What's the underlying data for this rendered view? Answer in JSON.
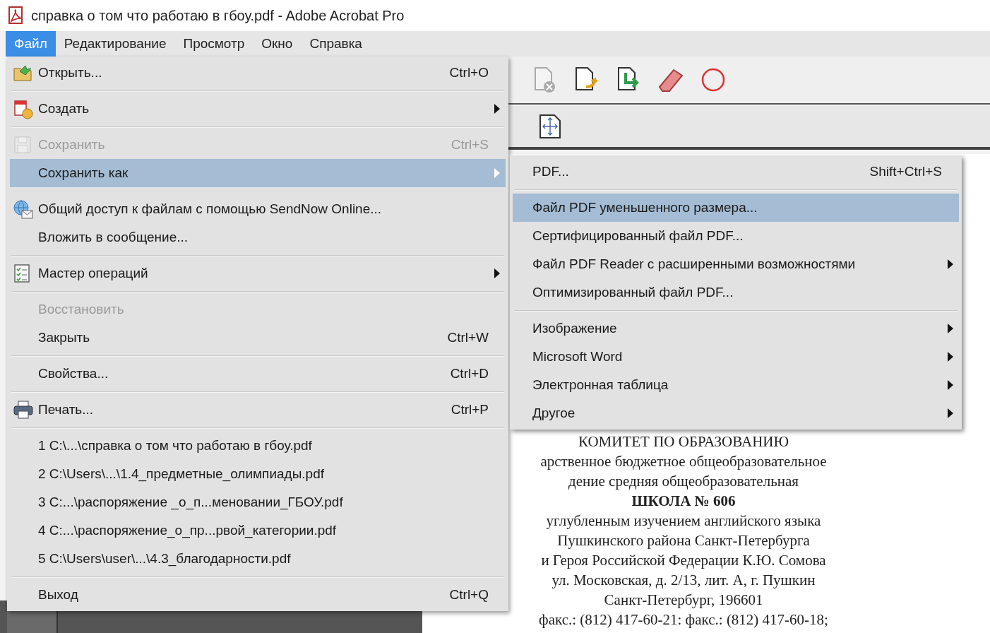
{
  "window": {
    "title": "справка о том что работаю в гбоу.pdf - Adobe Acrobat Pro"
  },
  "menubar": [
    {
      "label": "Файл",
      "selected": true
    },
    {
      "label": "Редактирование",
      "selected": false
    },
    {
      "label": "Просмотр",
      "selected": false
    },
    {
      "label": "Окно",
      "selected": false
    },
    {
      "label": "Справка",
      "selected": false
    }
  ],
  "file_menu": [
    {
      "kind": "item",
      "label": "Открыть...",
      "shortcut": "Ctrl+O",
      "has_submenu": false,
      "disabled": false,
      "selected": false
    },
    {
      "kind": "separator"
    },
    {
      "kind": "item",
      "label": "Создать",
      "has_submenu": true,
      "disabled": false,
      "selected": false
    },
    {
      "kind": "separator"
    },
    {
      "kind": "item",
      "label": "Сохранить",
      "shortcut": "Ctrl+S",
      "has_submenu": false,
      "disabled": true,
      "selected": false
    },
    {
      "kind": "item",
      "label": "Сохранить как",
      "has_submenu": true,
      "disabled": false,
      "selected": true
    },
    {
      "kind": "separator"
    },
    {
      "kind": "item",
      "label": "Общий доступ к файлам с помощью SendNow Online...",
      "has_submenu": false,
      "disabled": false,
      "selected": false
    },
    {
      "kind": "item",
      "label": "Вложить в сообщение...",
      "has_submenu": false,
      "disabled": false,
      "selected": false
    },
    {
      "kind": "separator"
    },
    {
      "kind": "item",
      "label": "Мастер операций",
      "has_submenu": true,
      "disabled": false,
      "selected": false
    },
    {
      "kind": "separator"
    },
    {
      "kind": "item",
      "label": "Восстановить",
      "has_submenu": false,
      "disabled": true,
      "selected": false
    },
    {
      "kind": "item",
      "label": "Закрыть",
      "shortcut": "Ctrl+W",
      "has_submenu": false,
      "disabled": false,
      "selected": false
    },
    {
      "kind": "separator"
    },
    {
      "kind": "item",
      "label": "Свойства...",
      "shortcut": "Ctrl+D",
      "has_submenu": false,
      "disabled": false,
      "selected": false
    },
    {
      "kind": "separator"
    },
    {
      "kind": "item",
      "label": "Печать...",
      "shortcut": "Ctrl+P",
      "has_submenu": false,
      "disabled": false,
      "selected": false
    },
    {
      "kind": "separator"
    },
    {
      "kind": "item",
      "label": "1 C:\\...\\справка о том что работаю в гбоу.pdf",
      "has_submenu": false,
      "disabled": false,
      "selected": false
    },
    {
      "kind": "item",
      "label": "2 C:\\Users\\...\\1.4_предметные_олимпиады.pdf",
      "has_submenu": false,
      "disabled": false,
      "selected": false
    },
    {
      "kind": "item",
      "label": "3 C:...\\распоряжение _о_п...меновании_ГБОУ.pdf",
      "has_submenu": false,
      "disabled": false,
      "selected": false
    },
    {
      "kind": "item",
      "label": "4 C:...\\распоряжение_о_пр...рвой_категории.pdf",
      "has_submenu": false,
      "disabled": false,
      "selected": false
    },
    {
      "kind": "item",
      "label": "5 C:\\Users\\user\\...\\4.3_благодарности.pdf",
      "has_submenu": false,
      "disabled": false,
      "selected": false
    },
    {
      "kind": "separator"
    },
    {
      "kind": "item",
      "label": "Выход",
      "shortcut": "Ctrl+Q",
      "has_submenu": false,
      "disabled": false,
      "selected": false
    }
  ],
  "save_as_menu": [
    {
      "kind": "item",
      "label": "PDF...",
      "shortcut": "Shift+Ctrl+S",
      "has_submenu": false,
      "selected": false
    },
    {
      "kind": "separator"
    },
    {
      "kind": "item",
      "label": "Файл PDF уменьшенного размера...",
      "has_submenu": false,
      "selected": true
    },
    {
      "kind": "item",
      "label": "Сертифицированный файл PDF...",
      "has_submenu": false,
      "selected": false
    },
    {
      "kind": "item",
      "label": "Файл PDF Reader с расширенными возможностями",
      "has_submenu": true,
      "selected": false
    },
    {
      "kind": "item",
      "label": "Оптимизированный файл PDF...",
      "has_submenu": false,
      "selected": false
    },
    {
      "kind": "separator"
    },
    {
      "kind": "item",
      "label": "Изображение",
      "has_submenu": true,
      "selected": false
    },
    {
      "kind": "item",
      "label": "Microsoft Word",
      "has_submenu": true,
      "selected": false
    },
    {
      "kind": "item",
      "label": "Электронная таблица",
      "has_submenu": true,
      "selected": false
    },
    {
      "kind": "item",
      "label": "Другое",
      "has_submenu": true,
      "selected": false
    }
  ],
  "document": {
    "lines": [
      {
        "kind": "text",
        "text": "КОМИТЕТ ПО ОБРАЗОВАНИЮ"
      },
      {
        "kind": "text",
        "text": "арственное бюджетное общеобразовательное"
      },
      {
        "kind": "text",
        "text": "дение средняя общеобразовательная"
      },
      {
        "kind": "heading",
        "text": "ШКОЛА № 606"
      },
      {
        "kind": "text",
        "text": "углубленным изучением английского языка"
      },
      {
        "kind": "text",
        "text": "Пушкинского района Санкт-Петербурга"
      },
      {
        "kind": "text",
        "text": "и Героя Российской Федерации К.Ю. Сомова"
      },
      {
        "kind": "text",
        "text": "ул. Московская, д. 2/13, лит. А, г. Пушкин"
      },
      {
        "kind": "text",
        "text": "Санкт-Петербург, 196601"
      },
      {
        "kind": "text",
        "text": "факс.: (812) 417-60-21: факс.: (812) 417-60-18;"
      }
    ]
  }
}
